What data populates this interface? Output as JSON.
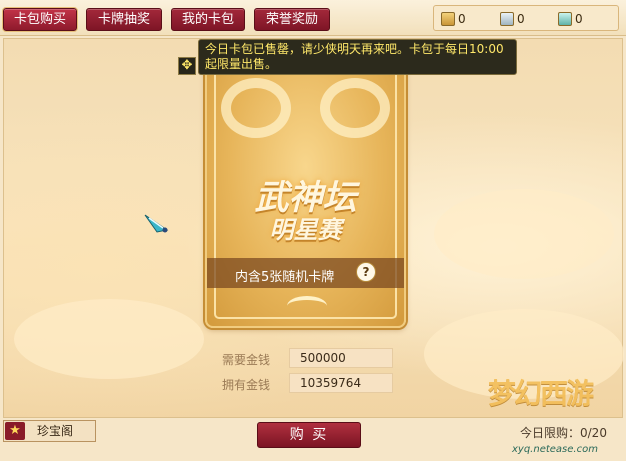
{
  "tabs": [
    {
      "label": "卡包购买",
      "active": true
    },
    {
      "label": "卡牌抽奖",
      "active": false
    },
    {
      "label": "我的卡包",
      "active": false
    },
    {
      "label": "荣誉奖励",
      "active": false
    }
  ],
  "currencies": [
    {
      "icon": "gold-coin-icon",
      "value": "0"
    },
    {
      "icon": "silver-coin-icon",
      "value": "0"
    },
    {
      "icon": "jade-coin-icon",
      "value": "0"
    }
  ],
  "tooltip": {
    "text": "今日卡包已售罄，请少侠明天再来吧。卡包于每日10:00起限量出售。"
  },
  "card": {
    "title_line1": "武神坛",
    "title_line2": "明星赛",
    "band_text": "内含5张随机卡牌",
    "help_label": "?"
  },
  "stats": {
    "required_label": "需要金钱",
    "required_value": "500000",
    "owned_label": "拥有金钱",
    "owned_value": "10359764"
  },
  "footer": {
    "treasure_label": "珍宝阁",
    "buy_label": "购 买",
    "daily_limit": "今日限购：0/20"
  },
  "watermark": {
    "logo": "梦幻西游",
    "url": "xyq.netease.com"
  },
  "colors": {
    "tab_bg": "#8e1a2c",
    "tooltip_text": "#ffe86a",
    "card_gold": "#e7b55a"
  }
}
